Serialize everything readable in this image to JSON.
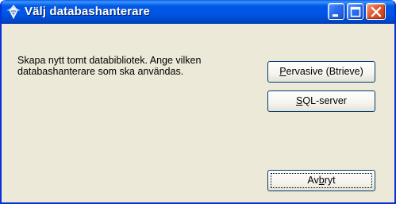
{
  "window": {
    "title": "Välj databashanterare",
    "icon": "database-manager-icon",
    "controls": [
      "minimize-icon",
      "maximize-icon",
      "close-icon"
    ],
    "colors": {
      "titlebar": "#0055e5",
      "close": "#e0582f",
      "face": "#ece9d8"
    }
  },
  "message": {
    "text": "Skapa nytt tomt databibliotek. Ange vilken databashanterare som ska användas."
  },
  "buttons": {
    "pervasive": {
      "accel": "P",
      "rest": "ervasive (Btrieve)"
    },
    "sql": {
      "accel": "S",
      "rest": "QL-server"
    },
    "cancel": {
      "pre": "Av",
      "accel": "b",
      "rest": "ryt"
    }
  }
}
